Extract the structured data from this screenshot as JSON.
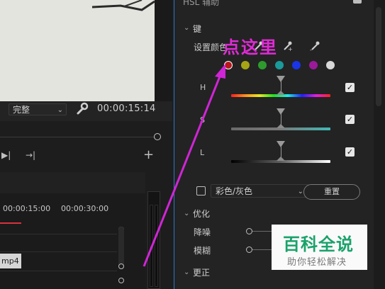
{
  "monitor": {
    "quality": "完整",
    "timecode": "00:00:15:14"
  },
  "timeline": {
    "ruler": [
      "00:00:15:00",
      "00:00:30:00"
    ],
    "clip_label": "mp4"
  },
  "lumetri": {
    "section_hsl": "HSL 辅助",
    "section_key": "键",
    "set_color_label": "设置颜色",
    "swatch_colors": [
      "#b8171b",
      "#a6a415",
      "#2d9c2d",
      "#1a9a9a",
      "#1a34e8",
      "#9a1a9a",
      "#d8d8d8"
    ],
    "hsl_rows": [
      {
        "label": "H",
        "checked": "✓"
      },
      {
        "label": "S",
        "checked": "✓"
      },
      {
        "label": "L",
        "checked": "✓"
      }
    ],
    "mode_select": "彩色/灰色",
    "reset_label": "重置",
    "section_refine": "优化",
    "denoise_label": "降噪",
    "blur_label": "模糊",
    "section_correct": "更正"
  },
  "annotation": {
    "text": "点这里"
  },
  "watermark": {
    "title": "百科全说",
    "subtitle": "助你轻松解决"
  }
}
